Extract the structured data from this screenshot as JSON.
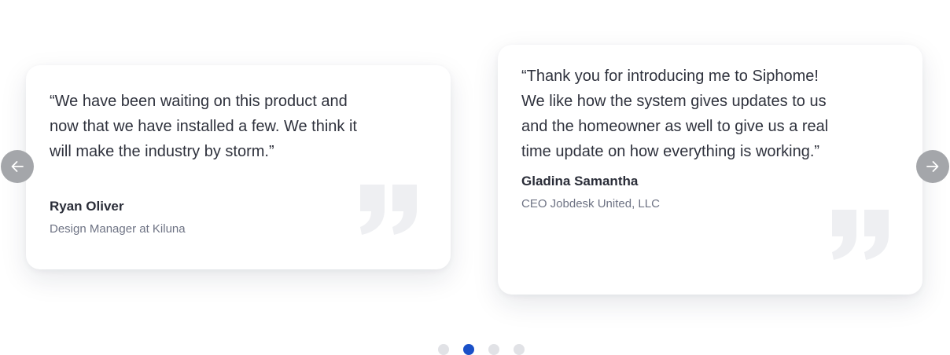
{
  "testimonials": [
    {
      "quote": "“We have been waiting on this product and now that we have installed a few. We think it will make the industry by storm.”",
      "name": "Ryan Oliver",
      "role": "Design Manager at Kiluna"
    },
    {
      "quote": "“Thank you for introducing me to Siphome!  We like how the system gives updates to us and the homeowner as well to give us a real time update on how everything is working.”",
      "name": "Gladina Samantha",
      "role": "CEO Jobdesk United, LLC"
    }
  ],
  "navigation": {
    "prev_icon": "arrow-left-icon",
    "next_icon": "arrow-right-icon",
    "dots_total": 4,
    "active_dot": 2
  },
  "colors": {
    "accent": "#1a50c8",
    "dot_inactive": "#e1e2e6",
    "arrow_bg": "#a4a6aa",
    "quote_mark": "#eeeff2",
    "text_primary": "#2f323d",
    "text_secondary": "#6e7384"
  }
}
